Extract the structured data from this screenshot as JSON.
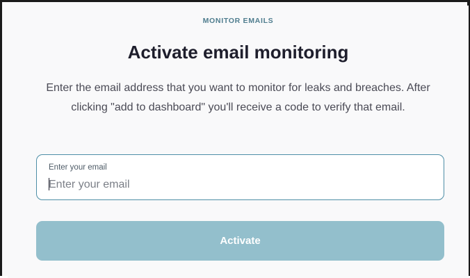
{
  "section": {
    "eyebrow": "MONITOR EMAILS",
    "title": "Activate email monitoring",
    "description": "Enter the email address that you want to monitor for leaks and breaches. After clicking \"add to dashboard\" you'll receive a code to verify that email."
  },
  "email_field": {
    "label": "Enter your email",
    "placeholder": "Enter your email",
    "value": ""
  },
  "activate_button": {
    "label": "Activate",
    "enabled": false
  },
  "colors": {
    "accent": "#4d8ea6",
    "button_disabled": "#93bfcc",
    "eyebrow": "#4f7d8e",
    "heading": "#1e1e2c",
    "background": "#f9f9fa"
  }
}
